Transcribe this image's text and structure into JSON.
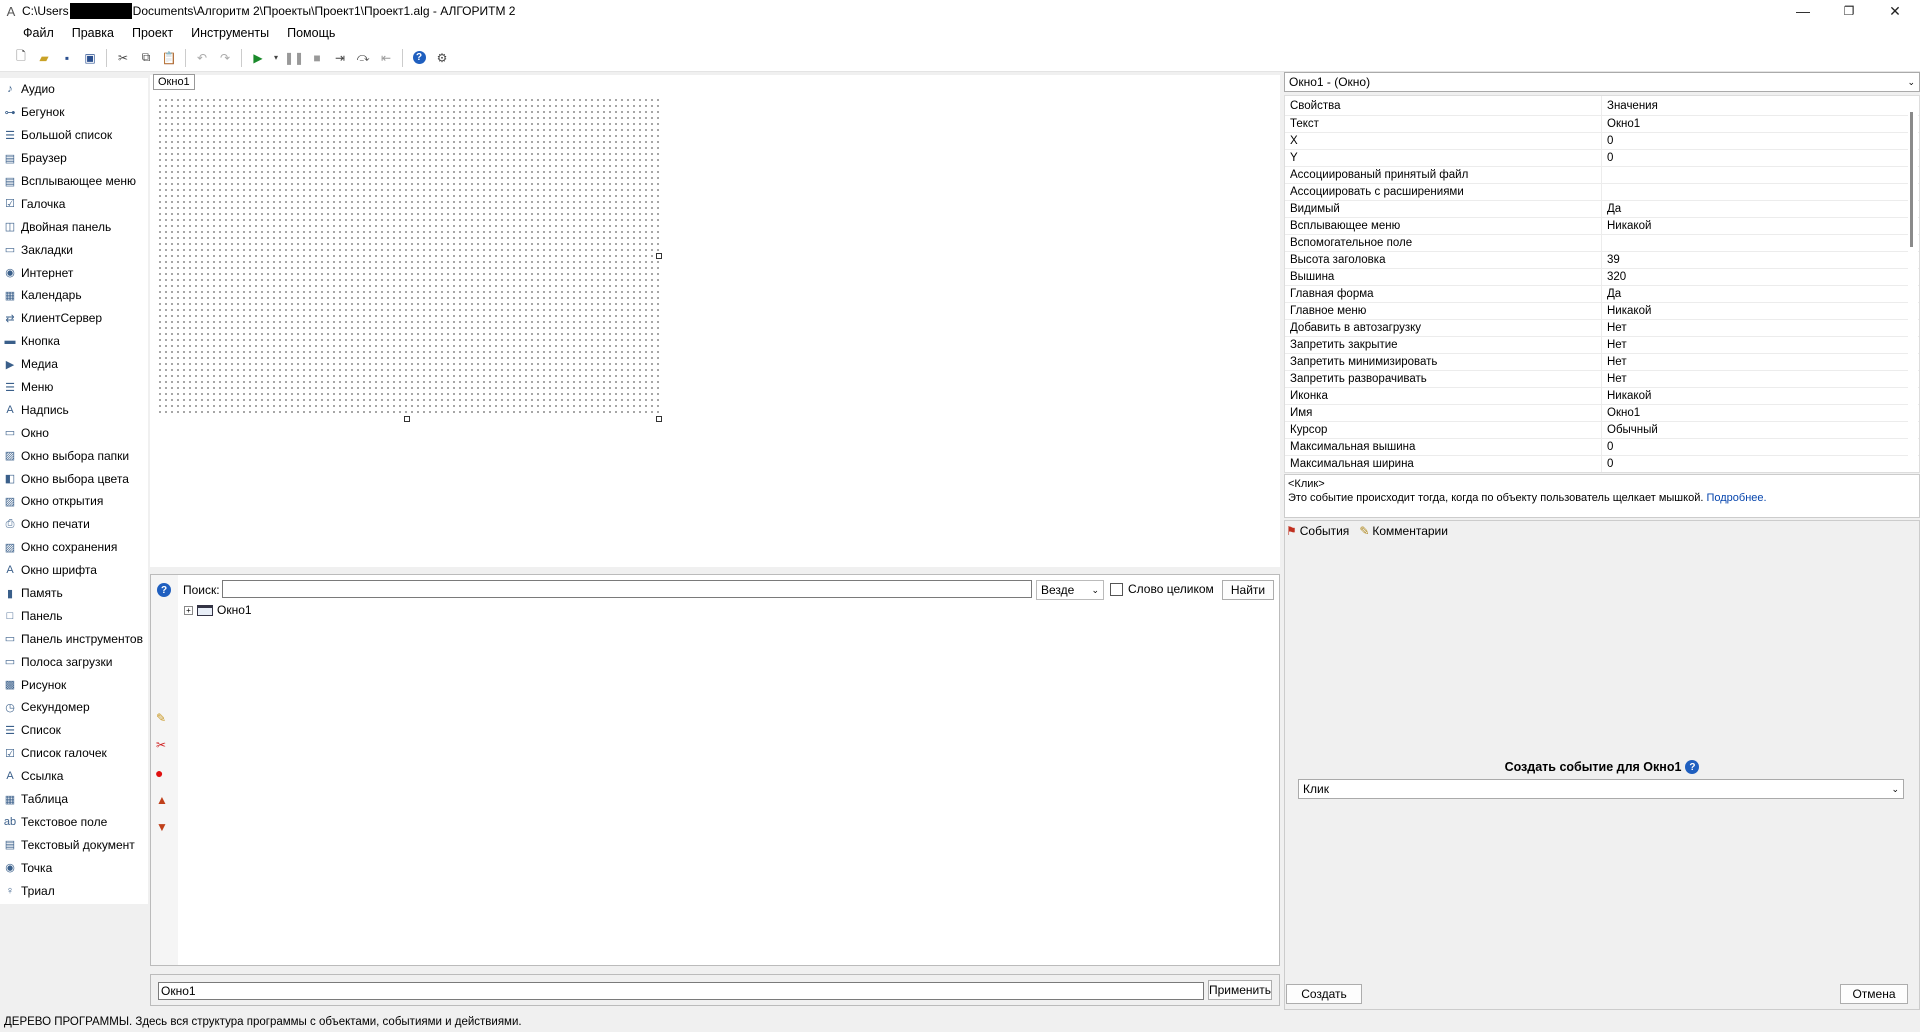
{
  "titlebar": {
    "path_prefix": "C:\\Users",
    "path_suffix": "Documents\\Алгоритм 2\\Проекты\\Проект1\\Проект1.alg - АЛГОРИТМ 2",
    "minimize": "—",
    "maximize": "❐",
    "close": "✕"
  },
  "menu": [
    "Файл",
    "Правка",
    "Проект",
    "Инструменты",
    "Помощь"
  ],
  "toolbar": {
    "icons": [
      "new-file-icon",
      "open-folder-icon",
      "save-icon",
      "save-all-icon",
      "cut-icon",
      "copy-icon",
      "paste-icon",
      "undo-icon",
      "redo-icon",
      "run-icon",
      "run-dropdown-icon",
      "pause-icon",
      "stop-icon",
      "step-into-icon",
      "step-over-icon",
      "step-out-icon",
      "help-icon",
      "settings-icon"
    ]
  },
  "components": [
    {
      "label": "Аудио",
      "icon": "audio-icon"
    },
    {
      "label": "Бегунок",
      "icon": "slider-icon"
    },
    {
      "label": "Большой список",
      "icon": "big-list-icon"
    },
    {
      "label": "Браузер",
      "icon": "browser-icon"
    },
    {
      "label": "Всплывающее меню",
      "icon": "popup-menu-icon"
    },
    {
      "label": "Галочка",
      "icon": "checkbox-icon"
    },
    {
      "label": "Двойная панель",
      "icon": "double-panel-icon"
    },
    {
      "label": "Закладки",
      "icon": "tabs-icon"
    },
    {
      "label": "Интернет",
      "icon": "globe-icon"
    },
    {
      "label": "Календарь",
      "icon": "calendar-icon"
    },
    {
      "label": "КлиентСервер",
      "icon": "client-server-icon"
    },
    {
      "label": "Кнопка",
      "icon": "button-icon"
    },
    {
      "label": "Медиа",
      "icon": "media-icon"
    },
    {
      "label": "Меню",
      "icon": "menu-icon"
    },
    {
      "label": "Надпись",
      "icon": "label-icon"
    },
    {
      "label": "Окно",
      "icon": "window-icon"
    },
    {
      "label": "Окно выбора папки",
      "icon": "folder-dialog-icon"
    },
    {
      "label": "Окно выбора цвета",
      "icon": "color-dialog-icon"
    },
    {
      "label": "Окно открытия",
      "icon": "open-dialog-icon"
    },
    {
      "label": "Окно печати",
      "icon": "print-dialog-icon"
    },
    {
      "label": "Окно сохранения",
      "icon": "save-dialog-icon"
    },
    {
      "label": "Окно шрифта",
      "icon": "font-dialog-icon"
    },
    {
      "label": "Память",
      "icon": "memory-icon"
    },
    {
      "label": "Панель",
      "icon": "panel-icon"
    },
    {
      "label": "Панель инструментов",
      "icon": "toolbar-icon"
    },
    {
      "label": "Полоса загрузки",
      "icon": "progress-bar-icon"
    },
    {
      "label": "Рисунок",
      "icon": "picture-icon"
    },
    {
      "label": "Секундомер",
      "icon": "stopwatch-icon"
    },
    {
      "label": "Список",
      "icon": "list-icon"
    },
    {
      "label": "Список галочек",
      "icon": "checklist-icon"
    },
    {
      "label": "Ссылка",
      "icon": "link-icon"
    },
    {
      "label": "Таблица",
      "icon": "table-icon"
    },
    {
      "label": "Текстовое поле",
      "icon": "text-field-icon"
    },
    {
      "label": "Текстовый документ",
      "icon": "text-document-icon"
    },
    {
      "label": "Точка",
      "icon": "point-icon"
    },
    {
      "label": "Триал",
      "icon": "trial-icon"
    }
  ],
  "designer": {
    "tab": "Окно1"
  },
  "tree": {
    "search_label": "Поиск:",
    "search_value": "",
    "scope": "Везде",
    "whole_word": "Слово целиком",
    "find_button": "Найти",
    "node": "Окно1",
    "name_value": "Окно1",
    "apply_button": "Применить"
  },
  "properties": {
    "object": "Окно1 - (Окно)",
    "col_name": "Свойства",
    "col_value": "Значения",
    "rows": [
      {
        "n": "Текст",
        "v": "Окно1"
      },
      {
        "n": "X",
        "v": "0"
      },
      {
        "n": "Y",
        "v": "0"
      },
      {
        "n": "Ассоциированый принятый файл",
        "v": ""
      },
      {
        "n": "Ассоциировать с расширениями",
        "v": ""
      },
      {
        "n": "Видимый",
        "v": "Да"
      },
      {
        "n": "Всплывающее меню",
        "v": "Никакой"
      },
      {
        "n": "Вспомогательное поле",
        "v": ""
      },
      {
        "n": "Высота заголовка",
        "v": "39"
      },
      {
        "n": "Вышина",
        "v": "320"
      },
      {
        "n": "Главная форма",
        "v": "Да"
      },
      {
        "n": "Главное меню",
        "v": "Никакой"
      },
      {
        "n": "Добавить в автозагрузку",
        "v": "Нет"
      },
      {
        "n": "Запретить закрытие",
        "v": "Нет"
      },
      {
        "n": "Запретить минимизировать",
        "v": "Нет"
      },
      {
        "n": "Запретить разворачивать",
        "v": "Нет"
      },
      {
        "n": "Иконка",
        "v": "Никакой"
      },
      {
        "n": "Имя",
        "v": "Окно1"
      },
      {
        "n": "Курсор",
        "v": "Обычный"
      },
      {
        "n": "Максимальная вышина",
        "v": "0"
      },
      {
        "n": "Максимальная ширина",
        "v": "0"
      }
    ],
    "desc_title": "<Клик>",
    "desc_text": "Это событие происходит тогда, когда по объекту пользователь щелкает мышкой.",
    "desc_link": "Подробнее."
  },
  "events": {
    "tab_events": "События",
    "tab_comments": "Комментарии",
    "create_label": "Создать событие для Окно1",
    "selected_event": "Клик",
    "create_button": "Создать",
    "cancel_button": "Отмена"
  },
  "status": "ДЕРЕВО ПРОГРАММЫ. Здесь вся структура программы с объектами, событиями и действиями."
}
